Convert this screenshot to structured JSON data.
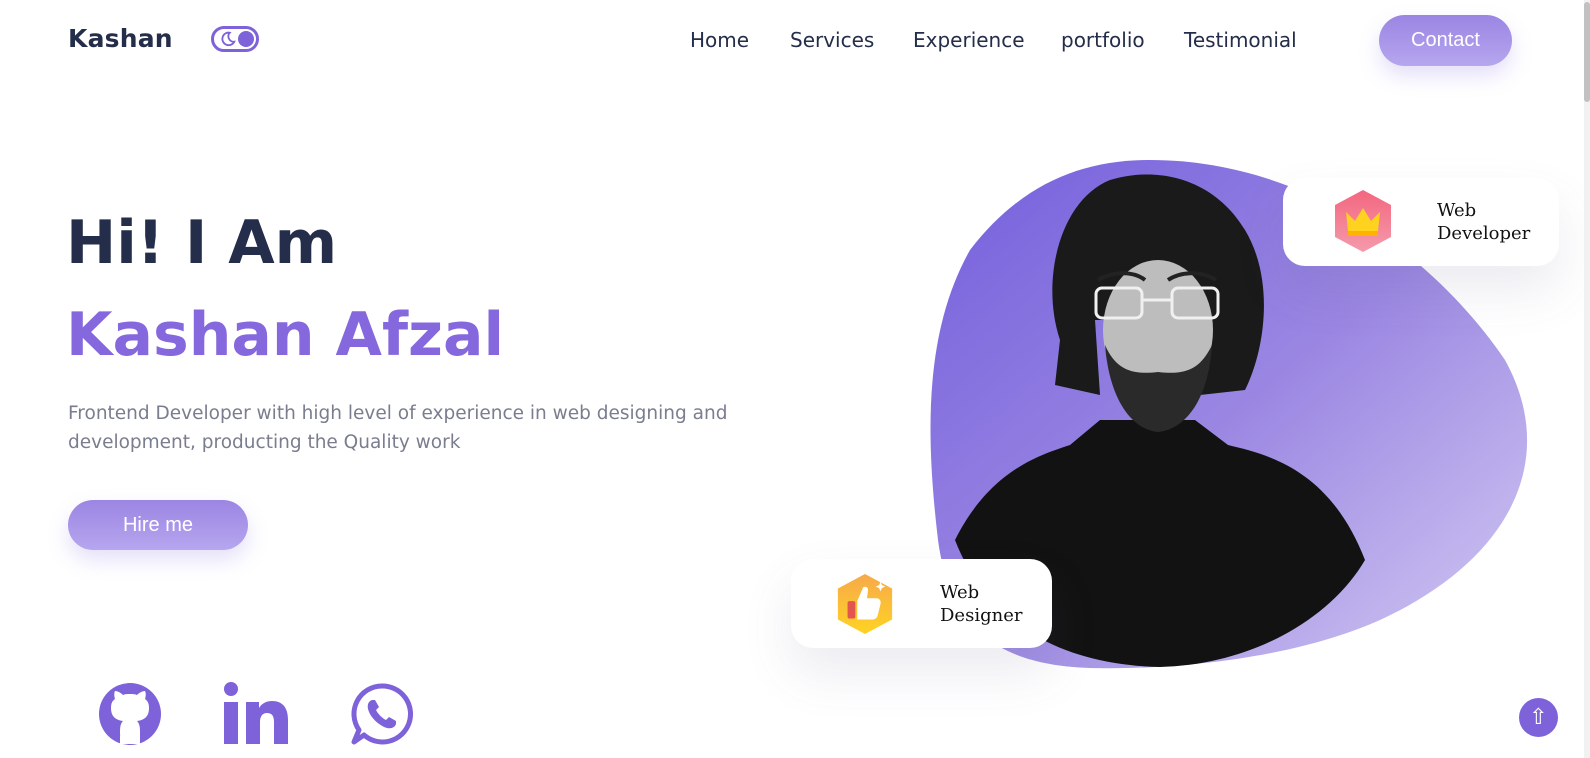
{
  "header": {
    "logo": "Kashan",
    "nav": [
      "Home",
      "Services",
      "Experience",
      "portfolio",
      "Testimonial"
    ],
    "contact_label": "Contact",
    "theme_toggle_icon": "moon-icon"
  },
  "hero": {
    "greeting": "Hi! I Am",
    "name": "Kashan Afzal",
    "description": "Frontend Developer with high level of experience in web designing and development, producting the Quality work",
    "hire_label": "Hire me"
  },
  "badges": [
    {
      "line1": "Web",
      "line2": "Developer",
      "icon": "crown-icon"
    },
    {
      "line1": "Web",
      "line2": "Designer",
      "icon": "thumbs-up-icon"
    }
  ],
  "social": [
    "github-icon",
    "linkedin-icon",
    "whatsapp-icon"
  ],
  "scroll_top_icon": "⇧",
  "colors": {
    "accent": "#7d62d9",
    "name": "#8568dd",
    "button_gradient_start": "#9b85e3",
    "button_gradient_end": "#b6a6ee",
    "heading": "#242d49",
    "text_muted": "#7a7d8e"
  }
}
